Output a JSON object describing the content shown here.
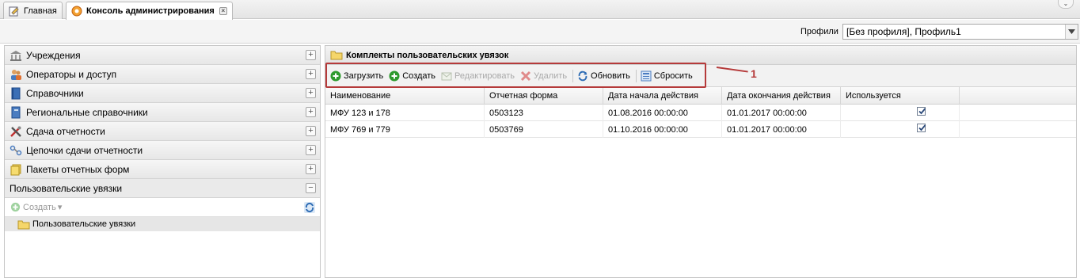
{
  "tabs": [
    {
      "label": "Главная",
      "icon": "edit-icon"
    },
    {
      "label": "Консоль администрирования",
      "icon": "console-icon",
      "active": true
    }
  ],
  "profile": {
    "label": "Профили",
    "value": "[Без профиля], Профиль1"
  },
  "sidebar": {
    "items": [
      {
        "label": "Учреждения",
        "icon": "institution-icon",
        "toggle": "+"
      },
      {
        "label": "Операторы и доступ",
        "icon": "users-icon",
        "toggle": "+"
      },
      {
        "label": "Справочники",
        "icon": "book-icon",
        "toggle": "+"
      },
      {
        "label": "Региональные справочники",
        "icon": "regional-book-icon",
        "toggle": "+"
      },
      {
        "label": "Сдача отчетности",
        "icon": "tools-icon",
        "toggle": "+"
      },
      {
        "label": "Цепочки сдачи отчетности",
        "icon": "chain-icon",
        "toggle": "+"
      },
      {
        "label": "Пакеты отчетных форм",
        "icon": "folder-stack-icon",
        "toggle": "+"
      },
      {
        "label": "Пользовательские увязки",
        "icon": "",
        "toggle": "−"
      }
    ],
    "create_label": "Создать",
    "tree_item": "Пользовательские увязки"
  },
  "main": {
    "title": "Комплекты пользовательских увязок",
    "toolbar": {
      "load": "Загрузить",
      "create": "Создать",
      "edit": "Редактировать",
      "delete": "Удалить",
      "refresh": "Обновить",
      "reset": "Сбросить"
    },
    "callout": "1",
    "columns": [
      "Наименование",
      "Отчетная форма",
      "Дата начала действия",
      "Дата окончания действия",
      "Используется"
    ],
    "rows": [
      {
        "name": "МФУ 123 и 178",
        "form": "0503123",
        "start": "01.08.2016 00:00:00",
        "end": "01.01.2017 00:00:00",
        "used": true
      },
      {
        "name": "МФУ 769 и 779",
        "form": "0503769",
        "start": "01.10.2016 00:00:00",
        "end": "01.01.2017 00:00:00",
        "used": true
      }
    ]
  },
  "colors": {
    "accent_red": "#b53a3a",
    "add_green": "#3aa03a",
    "delete_red": "#d04040"
  }
}
